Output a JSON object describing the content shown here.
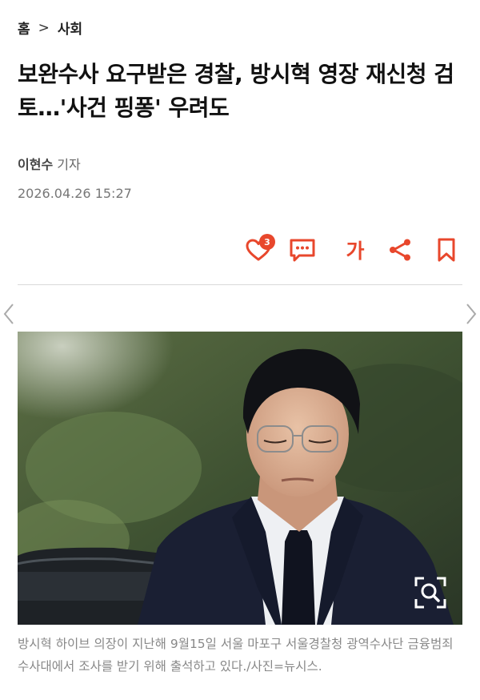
{
  "breadcrumb": {
    "home": "홈",
    "separator": ">",
    "section": "사회"
  },
  "article": {
    "title": "보완수사 요구받은 경찰, 방시혁 영장 재신청 검토…'사건 핑퐁' 우려도",
    "author_name": "이현수",
    "author_role": "기자",
    "date": "2026.04.26 15:27",
    "caption": "방시혁 하이브 의장이 지난해 9월15일 서울 마포구 서울경찰청 광역수사단 금융범죄수사대에서 조사를 받기 위해 출석하고 있다./사진=뉴시스."
  },
  "actions": {
    "like_count": "3",
    "font_label": "가"
  },
  "colors": {
    "accent": "#e8472c",
    "divider": "#d9d9d9",
    "caption": "#888888"
  },
  "icons": [
    "heart-icon",
    "comment-icon",
    "font-size-icon",
    "share-icon",
    "bookmark-icon",
    "chevron-left-icon",
    "chevron-right-icon",
    "zoom-search-icon"
  ]
}
